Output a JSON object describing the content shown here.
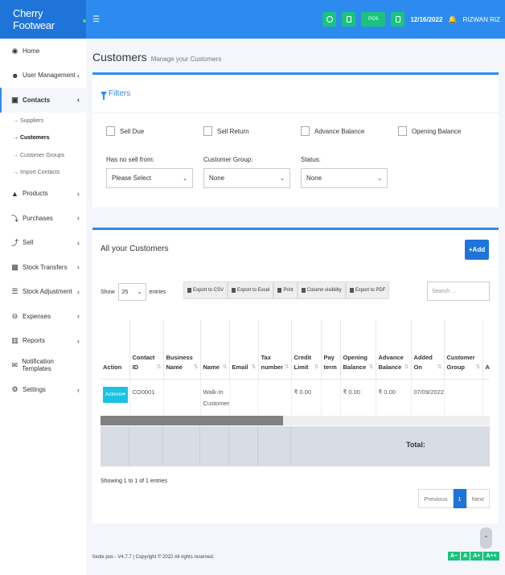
{
  "brand": {
    "name": "Cherry Footwear"
  },
  "topbar": {
    "pos_label": "POS",
    "date": "12/16/2022",
    "user": "RIZWAN RIZ"
  },
  "sidebar": {
    "items": [
      {
        "label": "Home",
        "icon": "dashboard-icon",
        "chev": ""
      },
      {
        "label": "User Management",
        "icon": "users-icon",
        "chev": "‹"
      },
      {
        "label": "Contacts",
        "icon": "address-book-icon",
        "chev": "‹"
      },
      {
        "label": "Products",
        "icon": "cubes-icon",
        "chev": "‹"
      },
      {
        "label": "Purchases",
        "icon": "arrow-down-icon",
        "chev": "‹"
      },
      {
        "label": "Sell",
        "icon": "arrow-up-icon",
        "chev": "‹"
      },
      {
        "label": "Stock Transfers",
        "icon": "truck-icon",
        "chev": "‹"
      },
      {
        "label": "Stock Adjustment",
        "icon": "database-icon",
        "chev": "‹"
      },
      {
        "label": "Expenses",
        "icon": "minus-circle-icon",
        "chev": "‹"
      },
      {
        "label": "Reports",
        "icon": "chart-icon",
        "chev": "‹"
      },
      {
        "label": "Notification Templates",
        "icon": "envelope-icon",
        "chev": ""
      },
      {
        "label": "Settings",
        "icon": "cog-icon",
        "chev": "‹"
      }
    ],
    "sub_items": [
      "→ Suppliers",
      "→ Customers",
      "→ Customer Groups",
      "→ Import Contacts"
    ]
  },
  "page": {
    "title": "Customers",
    "subtitle": "Manage your Customers"
  },
  "filters": {
    "title": "Filters",
    "checkboxes": [
      "Sell Due",
      "Sell Return",
      "Advance Balance",
      "Opening Balance"
    ],
    "has_no_sell_label": "Has no sell from:",
    "has_no_sell_value": "Please Select",
    "customer_group_label": "Customer Group:",
    "customer_group_value": "None",
    "status_label": "Status:",
    "status_value": "None"
  },
  "customers": {
    "title": "All your Customers",
    "add_label": "+Add",
    "show_label": "Show",
    "page_size": "25",
    "entries_label": "entries",
    "exports": [
      "Export to CSV",
      "Export to Excel",
      "Print",
      "Column visibility",
      "Export to PDF"
    ],
    "search_placeholder": "Search ...",
    "columns": [
      "Action",
      "Contact ID",
      "Business Name",
      "Name",
      "Email",
      "Tax number",
      "Credit Limit",
      "Pay term",
      "Opening Balance",
      "Advance Balance",
      "Added On",
      "Customer Group",
      "Ad"
    ],
    "rows": [
      {
        "action": "Actions▾",
        "contact_id": "CO0001",
        "business_name": "",
        "name": "Walk-In Customer",
        "email": "",
        "tax_number": "",
        "credit_limit": "₹ 0.00",
        "pay_term": "",
        "opening_balance": "₹ 0.00",
        "advance_balance": "₹ 0.00",
        "added_on": "07/09/2022",
        "customer_group": "",
        "ad": ""
      }
    ],
    "total_label": "Total:",
    "showing": "Showing 1 to 1 of 1 entries",
    "pager": {
      "previous": "Previous",
      "current": "1",
      "next": "Next"
    }
  },
  "footer": {
    "text": "footie pos - V4.7.7 | Copyright © 2022 All rights reserved."
  },
  "font_buttons": [
    "A−",
    "A",
    "A+",
    "A++"
  ],
  "colors": {
    "primary": "#2d8bf0",
    "brand": "#1f74d9",
    "success": "#19c37d",
    "info": "#19c3e0"
  }
}
